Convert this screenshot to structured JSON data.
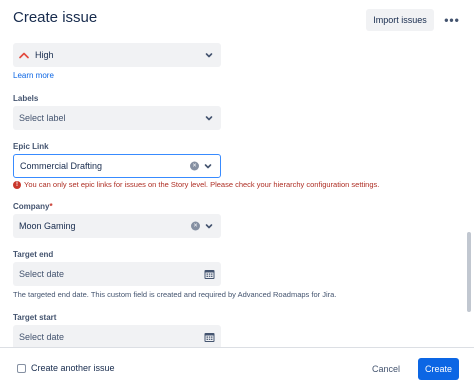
{
  "header": {
    "title": "Create issue",
    "import_label": "Import issues",
    "more_label": "•••"
  },
  "form": {
    "priority": {
      "value": "High",
      "learn_more": "Learn more"
    },
    "labels": {
      "label": "Labels",
      "placeholder": "Select label"
    },
    "epic_link": {
      "label": "Epic Link",
      "value": "Commercial Drafting",
      "error": "You can only set epic links for issues on the Story level. Please check your hierarchy configuration settings."
    },
    "company": {
      "label": "Company",
      "required_mark": "*",
      "value": "Moon Gaming"
    },
    "target_end": {
      "label": "Target end",
      "placeholder": "Select date",
      "helper": "The targeted end date. This custom field is created and required by Advanced Roadmaps for Jira."
    },
    "target_start": {
      "label": "Target start",
      "placeholder": "Select date"
    }
  },
  "footer": {
    "create_another": "Create another issue",
    "cancel_label": "Cancel",
    "create_label": "Create"
  },
  "colors": {
    "primary": "#0c66e4",
    "error": "#ae2e24",
    "priority_high": "#e2483d",
    "field_bg": "#f1f2f4",
    "focus_border": "#388bff"
  },
  "icons": [
    "priority-high-icon",
    "chevron-down-icon",
    "clear-icon",
    "calendar-icon",
    "error-icon",
    "more-icon"
  ]
}
